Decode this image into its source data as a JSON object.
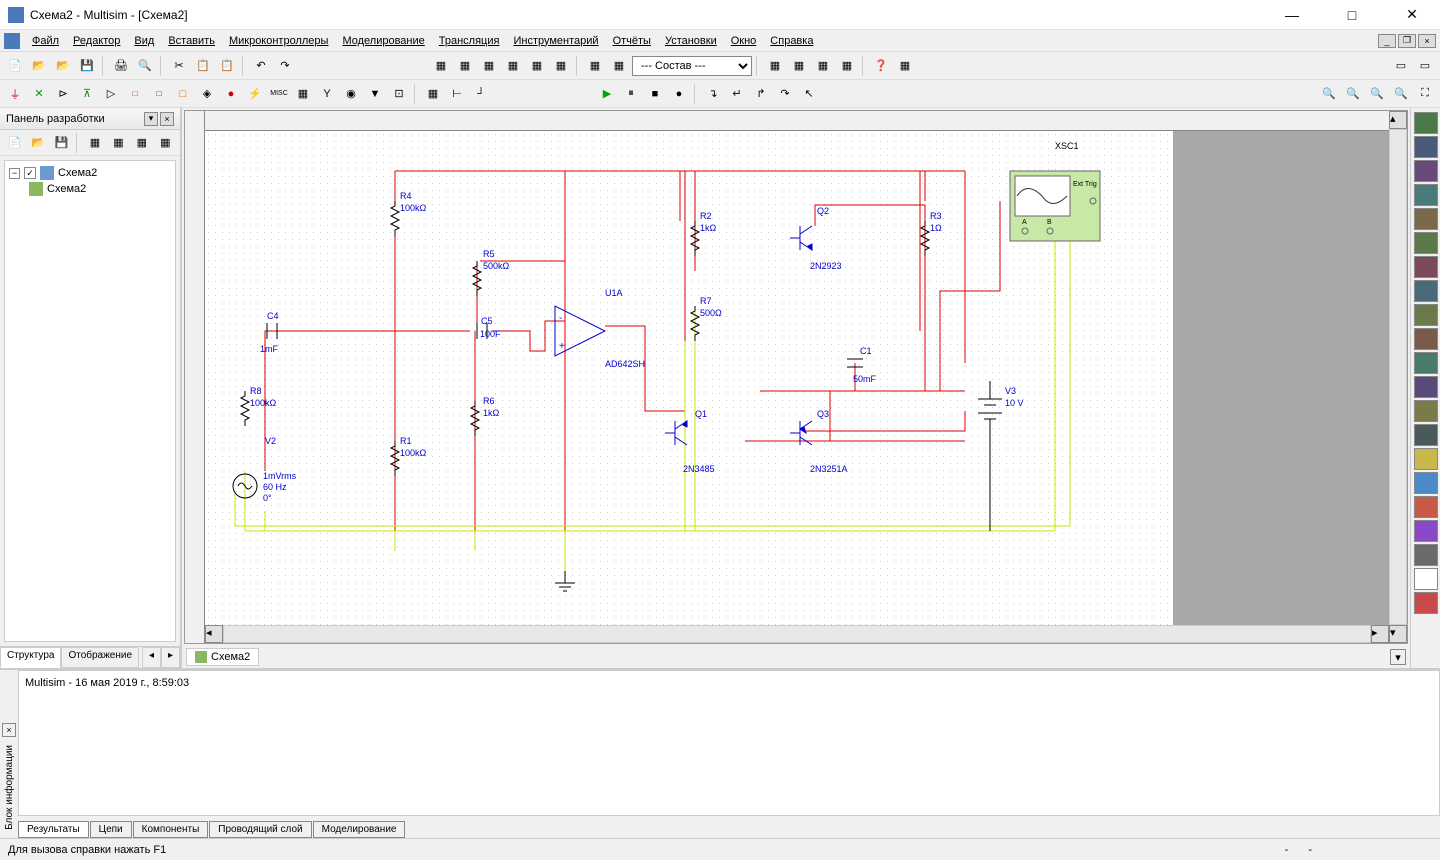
{
  "titlebar": {
    "text": "Схема2 - Multisim - [Схема2]"
  },
  "menu": {
    "items": [
      "Файл",
      "Редактор",
      "Вид",
      "Вставить",
      "Микроконтроллеры",
      "Моделирование",
      "Трансляция",
      "Инструментарий",
      "Отчёты",
      "Установки",
      "Окно",
      "Справка"
    ]
  },
  "toolbar2_select": "--- Состав ---",
  "left_panel": {
    "title": "Панель разработки",
    "tree_root": "Схема2",
    "tree_child": "Схема2",
    "tabs": [
      "Структура",
      "Отображение"
    ]
  },
  "canvas": {
    "tab": "Схема2"
  },
  "schematic": {
    "labels": {
      "R4": "R4",
      "R4v": "100kΩ",
      "R5": "R5",
      "R5v": "500kΩ",
      "R2": "R2",
      "R2v": "1kΩ",
      "Q2": "Q2",
      "Q2p": "2N2923",
      "R3": "R3",
      "R3v": "1Ω",
      "XSC1": "XSC1",
      "C4": "C4",
      "C4v": "1mF",
      "C5": "C5",
      "C5v": "100F",
      "U1A": "U1A",
      "U1Ap": "AD642SH",
      "R7": "R7",
      "R7v": "500Ω",
      "C1": "C1",
      "C1v": "50mF",
      "R8": "R8",
      "R8v": "100kΩ",
      "R6": "R6",
      "R6v": "1kΩ",
      "Q1": "Q1",
      "Q1p": "2N3485",
      "Q3": "Q3",
      "Q3p": "2N3251A",
      "V3": "V3",
      "V3v": "10 V",
      "V2": "V2",
      "V2v1": "1mVrms",
      "V2v2": "60 Hz",
      "V2v3": "0°",
      "R1": "R1",
      "R1v": "100kΩ",
      "scope_ext": "Ext Trig",
      "scope_a": "A",
      "scope_b": "B"
    }
  },
  "bottom": {
    "side_label": "Блок информации",
    "results_text": "Multisim  -  16 мая 2019 г., 8:59:03",
    "tabs": [
      "Результаты",
      "Цепи",
      "Компоненты",
      "Проводящий слой",
      "Моделирование"
    ]
  },
  "statusbar": {
    "text": "Для вызова справки нажать F1",
    "right1": "-",
    "right2": "-"
  }
}
